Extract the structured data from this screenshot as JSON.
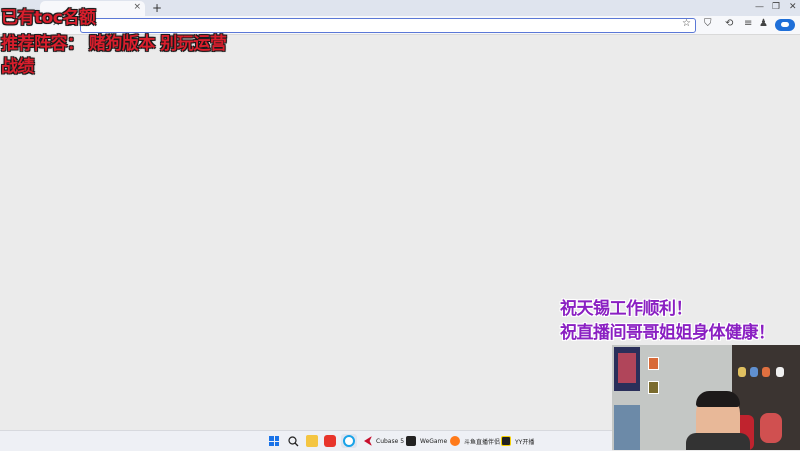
{
  "browser": {
    "new_tab_label": "+",
    "tab_close_label": "×",
    "window_controls": [
      "—",
      "❐",
      "✕"
    ],
    "nav_icons": [
      "←",
      "→",
      "✕",
      "⌂"
    ],
    "toolbar_icons": [
      "⛉",
      "⟲",
      "≡",
      "♟"
    ],
    "star_icon": "☆"
  },
  "overlays": {
    "line1": "已有toc名额",
    "line2": "推荐阵容：  赌狗版本  别玩运营",
    "line3": "战绩",
    "wish1": "祝天锡工作顺利！",
    "wish2": "祝直播间哥哥姐姐身体健康！"
  },
  "taskbar": {
    "apps": [
      {
        "label": "",
        "icon": "windows-start-icon"
      },
      {
        "label": "",
        "icon": "search-icon"
      },
      {
        "label": "",
        "icon": "file-explorer-icon"
      },
      {
        "label": "",
        "icon": "wps-icon"
      },
      {
        "label": "",
        "icon": "browser-icon"
      },
      {
        "label": "Cubase 5",
        "icon": "cubase-icon"
      },
      {
        "label": "WeGame",
        "icon": "wegame-icon"
      },
      {
        "label": "斗鱼直播伴侣",
        "icon": "douyu-icon"
      },
      {
        "label": "YY开播",
        "icon": "yy-icon"
      }
    ]
  },
  "colors": {
    "overlay_red": "#d81e2c",
    "overlay_purple": "#8a1fc2",
    "accent_blue": "#1a73e8"
  }
}
